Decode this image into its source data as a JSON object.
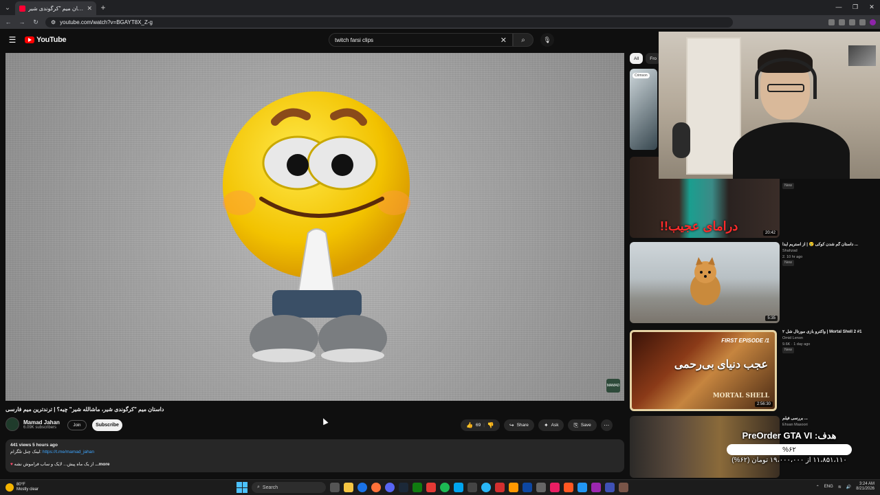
{
  "browser": {
    "tab_title": "داستان میم \"کرگوندی شیر\"...",
    "new_tab": "+",
    "url": "youtube.com/watch?v=BGAYT8X_Z-g"
  },
  "youtube": {
    "logo_text": "YouTube",
    "search_value": "twitch farsi clips",
    "video": {
      "title": "داستان میم \"کرگوندی شیر، ماشالله شیر\" چیه؟ | ترندترین میم فارسی",
      "channel_name": "Mamad Jahan",
      "subscribers": "6.09K subscribers",
      "join_label": "Join",
      "subscribe_label": "Subscribe",
      "likes": "69",
      "share_label": "Share",
      "ask_label": "Ask",
      "save_label": "Save",
      "views_line": "441 views  5 hours ago",
      "desc_line": "لینک چنل تلگرام:",
      "desc_link": "https://t.me/mamad_jahan",
      "desc_more_text": "از یک ماه پیش... لایک و ساب فراموش نشه",
      "more_label": "...more",
      "channel_badge": "MAMAD"
    },
    "chips": [
      "All",
      "Fro"
    ],
    "recommendations": [
      {
        "badge": "Crimson",
        "title": "",
        "channel": "",
        "meta": ""
      },
      {
        "duration": "20:42",
        "overlay": "درامای عجیب!!",
        "title": "",
        "channel": "",
        "meta": "",
        "new": "New"
      },
      {
        "duration": "5:35",
        "title": "داستان گم شدن کوکی 😢 | از استریم آیدا ...",
        "channel": "Shahzad",
        "meta": "2. 10 hr ago",
        "new": "New"
      },
      {
        "duration": "2:56:30",
        "ep": "FIRST EPISODE /1",
        "overlay": "عجب دنیای بی‌رحمی",
        "logo": "MORTAL SHELL",
        "title": "واکترو بازی مورتال شل ۲ | Mortal Shell 2 #1",
        "channel": "Omid Lenon",
        "meta": "9.6K · 1 day ago",
        "new": "New"
      },
      {
        "title": "بررسی فیلم ...",
        "channel": "Ehsan Masoori",
        "meta": ""
      }
    ]
  },
  "donation": {
    "title": "هدف: PreOrder GTA VI",
    "percent": "%۶۲",
    "percent_value": 62,
    "amount": "۱۱،۸۵۱،۱۱۰ از ۱۹،۰۰۰،۰۰۰ تومان (۶۲%)"
  },
  "taskbar": {
    "weather_temp": "80°F",
    "weather_desc": "Mostly clear",
    "search_label": "Search",
    "lang": "ENG",
    "time": "3:24 AM",
    "date": "8/21/2026"
  }
}
